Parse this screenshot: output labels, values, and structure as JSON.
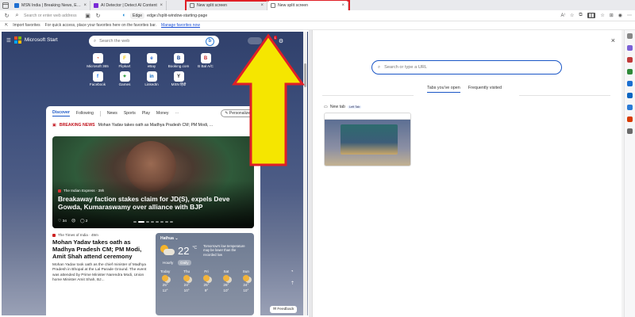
{
  "tabs": [
    {
      "label": "MSN India | Breaking News, Ente",
      "active": false
    },
    {
      "label": "AI Detector | Detect AI Content",
      "active": false
    }
  ],
  "split_tabs": [
    {
      "label": "New split screen",
      "active": false
    },
    {
      "label": "New split screen",
      "active": true
    }
  ],
  "address": {
    "left_placeholder": "Search or enter web address",
    "right_chip": "Edge",
    "right_url": "edge://split-window-starting-page"
  },
  "favorites_bar": {
    "import_label": "Import favorites",
    "hint": "For quick access, place your favorites here on the favorites bar.",
    "manage_link": "Manage favorites now"
  },
  "msn": {
    "brand": "Microsoft Start",
    "search_placeholder": "Search the web",
    "notification_count": "1",
    "quick_links": [
      {
        "label": "Microsoft 365",
        "icon": "m365-icon",
        "color": "#d83b01",
        "glyph": "◔"
      },
      {
        "label": "Flipkart",
        "icon": "flipkart-icon",
        "color": "#f7c600",
        "glyph": "F"
      },
      {
        "label": "eBay",
        "icon": "ebay-icon",
        "color": "#2b6cd8",
        "glyph": "e"
      },
      {
        "label": "Booking.com",
        "icon": "booking-icon",
        "color": "#0b3d91",
        "glyph": "B"
      },
      {
        "label": "B Bal A/C",
        "icon": "bank-icon",
        "color": "#c82a2a",
        "glyph": "B"
      },
      {
        "label": "Facebook",
        "icon": "facebook-icon",
        "color": "#1877f2",
        "glyph": "f"
      },
      {
        "label": "Games",
        "icon": "games-icon",
        "color": "#2a9d3a",
        "glyph": "✦"
      },
      {
        "label": "LinkedIn",
        "icon": "linkedin-icon",
        "color": "#0a66c2",
        "glyph": "in"
      },
      {
        "label": "MSN हिंदी",
        "icon": "msn-hindi-icon",
        "color": "#2c2c2c",
        "glyph": "Y"
      }
    ],
    "feed_tabs": [
      "Discover",
      "Following",
      "News",
      "Sports",
      "Play",
      "Money"
    ],
    "personalize_label": "Personalize",
    "breaking": {
      "label": "BREAKING NEWS",
      "text": "Mohan Yadav takes oath as Madhya Pradesh CM; PM Modi, ..."
    },
    "hero": {
      "source": "The Indian Express · 39h",
      "headline": "Breakaway faction stakes claim for JD(S), expels Deve Gowda, Kumaraswamy over alliance with BJP",
      "likes": "34",
      "comments": "2"
    },
    "story": {
      "source": "The Times of India · 49m",
      "title": "Mohan Yadav takes oath as Madhya Pradesh CM; PM Modi, Amit Shah attend ceremony",
      "body": "Mohan Yadav took oath as the chief minister of Madhya Pradesh in Bhopal at the Lal Parade Ground. The event was attended by Prime Minister Narendra Modi, Union home Minister Amit Shah, BJ..."
    },
    "weather": {
      "location": "Hathua",
      "temp": "22",
      "unit": "°C",
      "note": "Tomorrow's low temperature may be lower than the recorded low",
      "modes": [
        "Hourly",
        "Daily"
      ],
      "days": [
        {
          "name": "Today",
          "high": "25°",
          "low": "12°"
        },
        {
          "name": "Thu",
          "high": "24°",
          "low": "10°"
        },
        {
          "name": "Fri",
          "high": "25°",
          "low": "9°"
        },
        {
          "name": "Sat",
          "high": "26°",
          "low": "10°"
        },
        {
          "name": "Sun",
          "high": "24°",
          "low": "10°"
        }
      ]
    },
    "feedback_label": "Feedback"
  },
  "split_page": {
    "url_placeholder": "Search or type a URL",
    "tabs": [
      "Tabs you've open",
      "Frequently visited"
    ],
    "card_title": "New tab",
    "card_chip": "Left Tab"
  },
  "colors": {
    "accent": "#1a56c6",
    "highlight_border": "#e01f26",
    "arrow_fill": "#f5e600",
    "arrow_stroke": "#e01f26"
  }
}
